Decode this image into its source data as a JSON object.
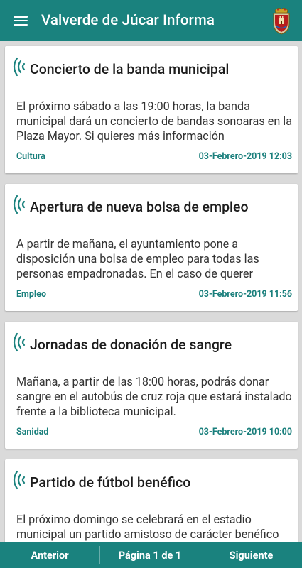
{
  "header": {
    "title": "Valverde de Júcar Informa",
    "menu_icon": "hamburger-menu-icon",
    "crest_icon": "coat-of-arms-icon"
  },
  "news": [
    {
      "title": "Concierto de la banda municipal",
      "body": "El próximo sábado a las 19:00 horas, la banda municipal dará un concierto de bandas sonoaras en la Plaza Mayor. Si quieres más información",
      "category": "Cultura",
      "date": "03-Febrero-2019 12:03"
    },
    {
      "title": "Apertura de nueva bolsa de empleo",
      "body": "A partir de mañana, el ayuntamiento pone a disposición una bolsa de empleo para todas las personas empadronadas. En el caso de querer",
      "category": "Empleo",
      "date": "03-Febrero-2019 11:56"
    },
    {
      "title": "Jornadas de donación de sangre",
      "body": "Mañana, a partir de las 18:00 horas, podrás donar sangre en el autobús de cruz roja que estará instalado frente a la biblioteca municipal.",
      "category": "Sanidad",
      "date": "03-Febrero-2019 10:00"
    },
    {
      "title": "Partido de fútbol benéfico",
      "body": "El próximo domingo se celebrará en el estadio municipal un partido amistoso de carácter benéfico",
      "category": "",
      "date": ""
    }
  ],
  "pagination": {
    "prev_label": "Anterior",
    "page_label": "Página 1 de 1",
    "next_label": "Siguiente"
  },
  "colors": {
    "primary": "#1a827e",
    "accent_text": "#1a7f7c"
  }
}
